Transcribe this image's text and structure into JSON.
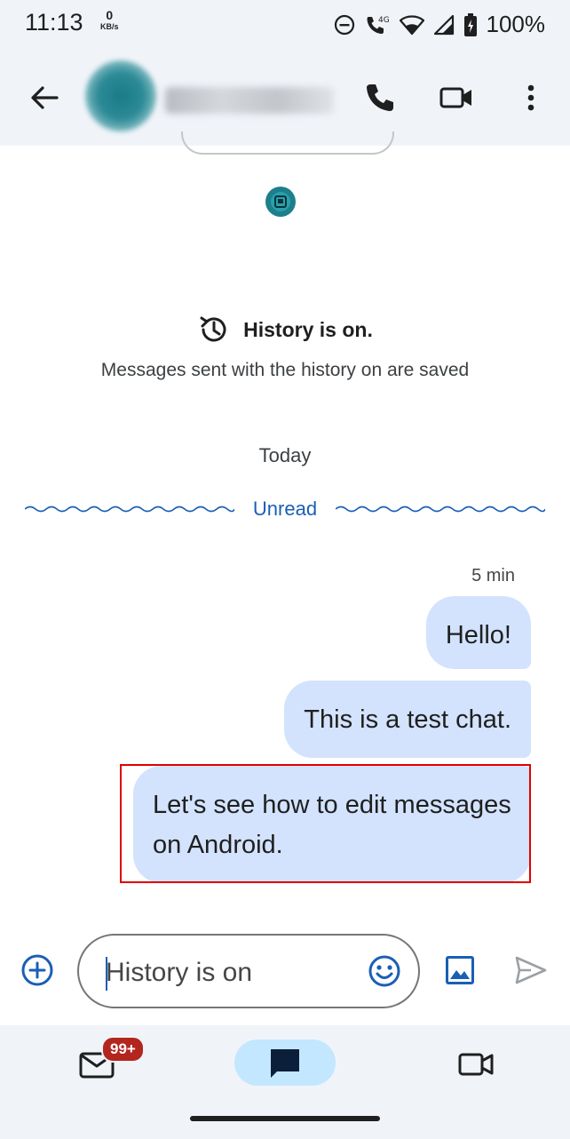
{
  "status_bar": {
    "time": "11:13",
    "net_speed_value": "0",
    "net_speed_unit": "KB/s",
    "network_type": "4G",
    "battery": "100%"
  },
  "header": {
    "icons": {
      "back": "arrow-back-icon",
      "call": "phone-icon",
      "video": "videocam-icon",
      "more": "more-vert-icon"
    }
  },
  "conversation": {
    "history_title": "History is on.",
    "history_subtitle": "Messages sent with the history on are saved",
    "date_divider": "Today",
    "unread_divider": "Unread",
    "last_time": "5 min",
    "messages": [
      {
        "text": "Hello!"
      },
      {
        "text": "This is a test chat."
      },
      {
        "text": "Let's see how to edit messages on Android."
      }
    ]
  },
  "composer": {
    "placeholder": "History is on",
    "icons": {
      "add": "add-circle-icon",
      "emoji": "emoji-icon",
      "image": "image-icon",
      "send": "send-icon"
    }
  },
  "bottom_nav": {
    "mail_badge": "99+",
    "items": [
      {
        "name": "mail",
        "icon": "mail-icon"
      },
      {
        "name": "chat",
        "icon": "chat-icon",
        "selected": true
      },
      {
        "name": "meet",
        "icon": "videocam-outline-icon"
      }
    ]
  },
  "colors": {
    "bubble": "#d3e3fd",
    "accent": "#1a5fb4",
    "highlight_box": "#e00000",
    "badge": "#b3261e",
    "selected_pill": "#c2e7ff"
  }
}
